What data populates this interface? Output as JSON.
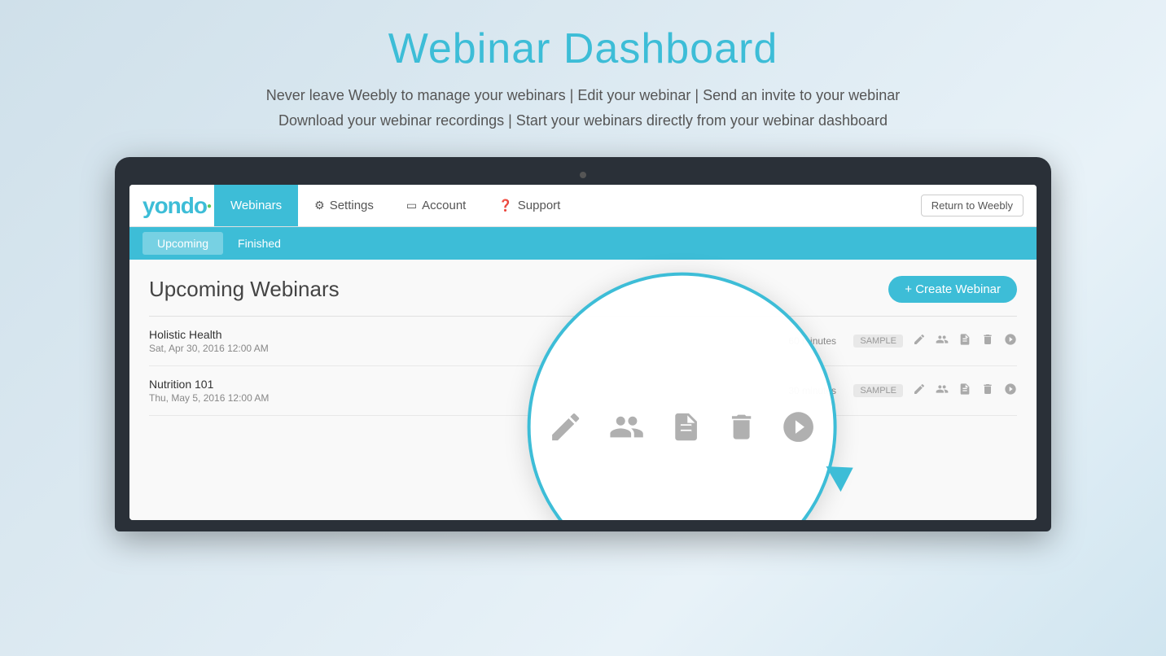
{
  "hero": {
    "title": "Webinar Dashboard",
    "subtitle_line1": "Never leave Weebly to manage your webinars  |  Edit your webinar  |   Send an invite to your webinar",
    "subtitle_line2": "Download your webinar recordings  |  Start your webinars directly from your webinar dashboard"
  },
  "nav": {
    "logo": "yondo",
    "items": [
      {
        "label": "Webinars",
        "active": true,
        "icon": ""
      },
      {
        "label": "Settings",
        "active": false,
        "icon": "⚙"
      },
      {
        "label": "Account",
        "active": false,
        "icon": "💳"
      },
      {
        "label": "Support",
        "active": false,
        "icon": "❓"
      }
    ],
    "return_button": "Return to Weebly"
  },
  "sub_nav": {
    "tabs": [
      {
        "label": "Upcoming",
        "active": true
      },
      {
        "label": "Finished",
        "active": false
      }
    ]
  },
  "main": {
    "section_title": "Upcoming Webinars",
    "create_button": "+ Create Webinar",
    "webinars": [
      {
        "name": "Holistic Health",
        "date": "Sat, Apr 30, 2016 12:00 AM",
        "duration": "60 minutes",
        "badge": "SAMPLE"
      },
      {
        "name": "Nutrition 101",
        "date": "Thu, May 5, 2016 12:00 AM",
        "duration": "30 minutes",
        "badge": "SAMPLE"
      }
    ]
  },
  "zoom": {
    "icons": [
      "edit",
      "attendees",
      "recording",
      "delete",
      "play"
    ]
  }
}
